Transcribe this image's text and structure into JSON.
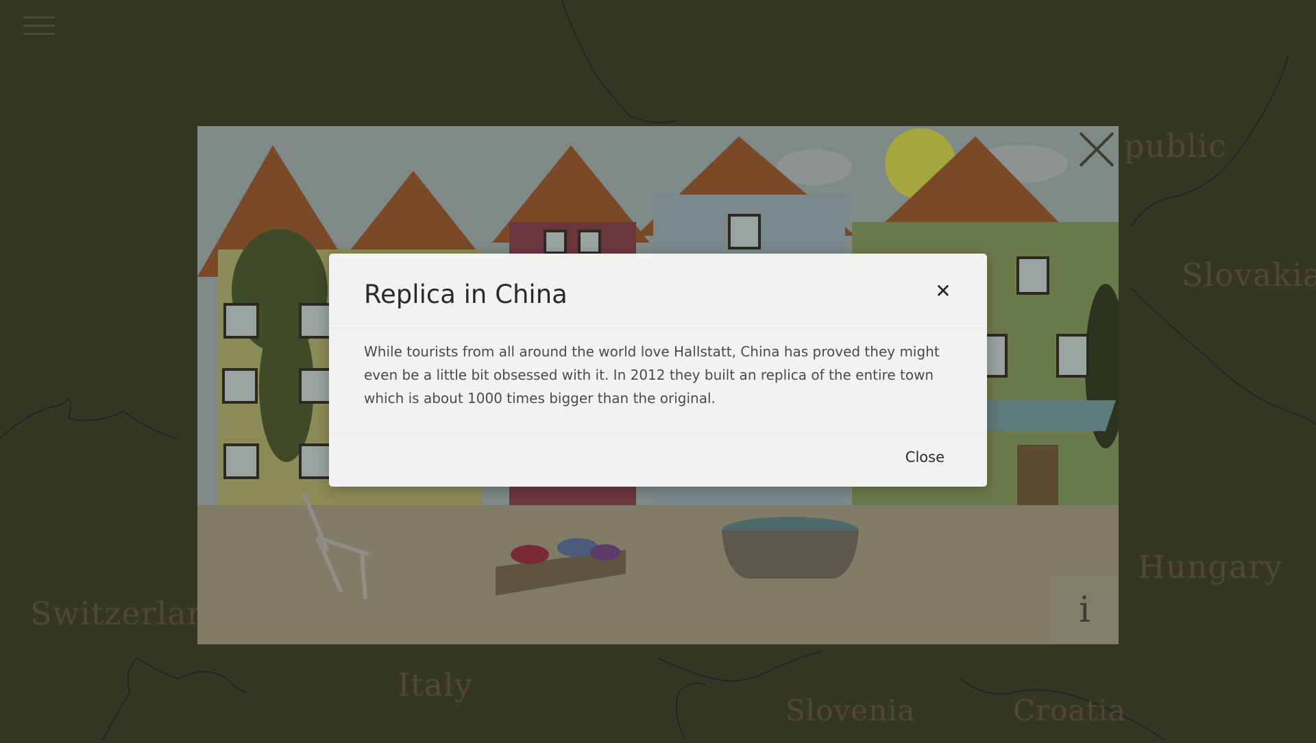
{
  "map": {
    "labels": [
      "Switzerland",
      "Italy",
      "Slovenia",
      "Croatia",
      "Hungary",
      "Slovakia",
      "public"
    ]
  },
  "menu": {
    "icon": "hamburger-menu-icon"
  },
  "scene": {
    "close_icon": "close-icon",
    "info_label": "i"
  },
  "modal": {
    "title": "Replica in China",
    "close_icon_glyph": "✕",
    "body": "While tourists from all around the world love Hallstatt, China has proved they might even be a little bit obsessed with it. In 2012 they built an replica of the entire town which is about 1000 times bigger than the original.",
    "close_label": "Close"
  }
}
